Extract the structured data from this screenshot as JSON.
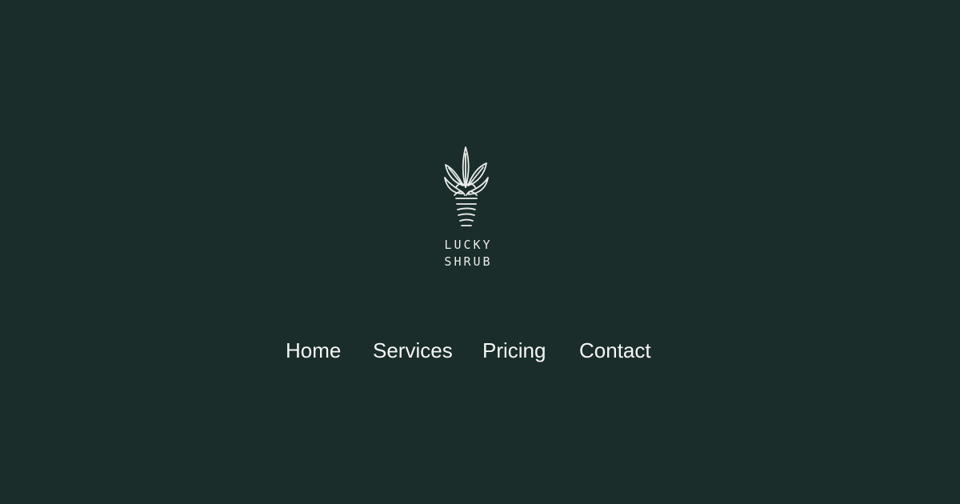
{
  "brand": {
    "line1": "LUCKY",
    "line2": "SHRUB",
    "logo_icon": "succulent-plant-icon"
  },
  "nav": {
    "items": [
      {
        "label": "Home"
      },
      {
        "label": "Services"
      },
      {
        "label": "Pricing"
      },
      {
        "label": "Contact"
      }
    ]
  },
  "colors": {
    "background": "#1a2d2a",
    "foreground": "#f2f4f3"
  }
}
